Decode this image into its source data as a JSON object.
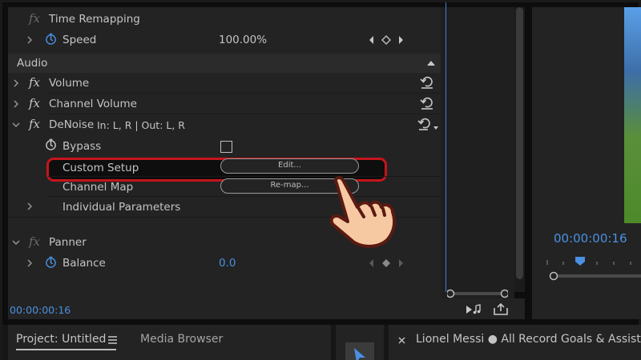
{
  "effect_controls": {
    "time_remapping": {
      "label": "Time Remapping"
    },
    "speed": {
      "label": "Speed",
      "value": "100.00%"
    },
    "audio_header": "Audio",
    "volume": {
      "label": "Volume"
    },
    "channel_volume": {
      "label": "Channel Volume"
    },
    "denoise": {
      "label": "DeNoise",
      "routing": "In: L, R | Out: L, R"
    },
    "bypass": {
      "label": "Bypass"
    },
    "custom_setup": {
      "label": "Custom Setup",
      "button": "Edit..."
    },
    "channel_map": {
      "label": "Channel Map",
      "button": "Re-map..."
    },
    "individual_parameters": {
      "label": "Individual Parameters"
    },
    "panner": {
      "label": "Panner"
    },
    "balance": {
      "label": "Balance",
      "value": "0.0"
    }
  },
  "status": {
    "timecode": "00:00:00:16"
  },
  "program_monitor": {
    "timecode": "00:00:00:16"
  },
  "bottom_tabs": {
    "project": "Project: Untitled",
    "media_browser": "Media Browser",
    "sequence": "Lionel Messi ● All Record Goals & Assists in C"
  },
  "icons": {
    "stopwatch": "stopwatch-icon",
    "reset": "reset-parameter-icon",
    "fx": "fx-badge-icon",
    "keyframe": "keyframe-navigator-icon",
    "menu": "hamburger-menu-icon",
    "close": "close-icon",
    "selection": "selection-tool-icon",
    "hand": "pointing-hand-icon"
  },
  "colors": {
    "panel_bg": "#232323",
    "accent_blue": "#4a90e2",
    "highlight_red": "#c4151c",
    "text": "#c4c4c4"
  }
}
